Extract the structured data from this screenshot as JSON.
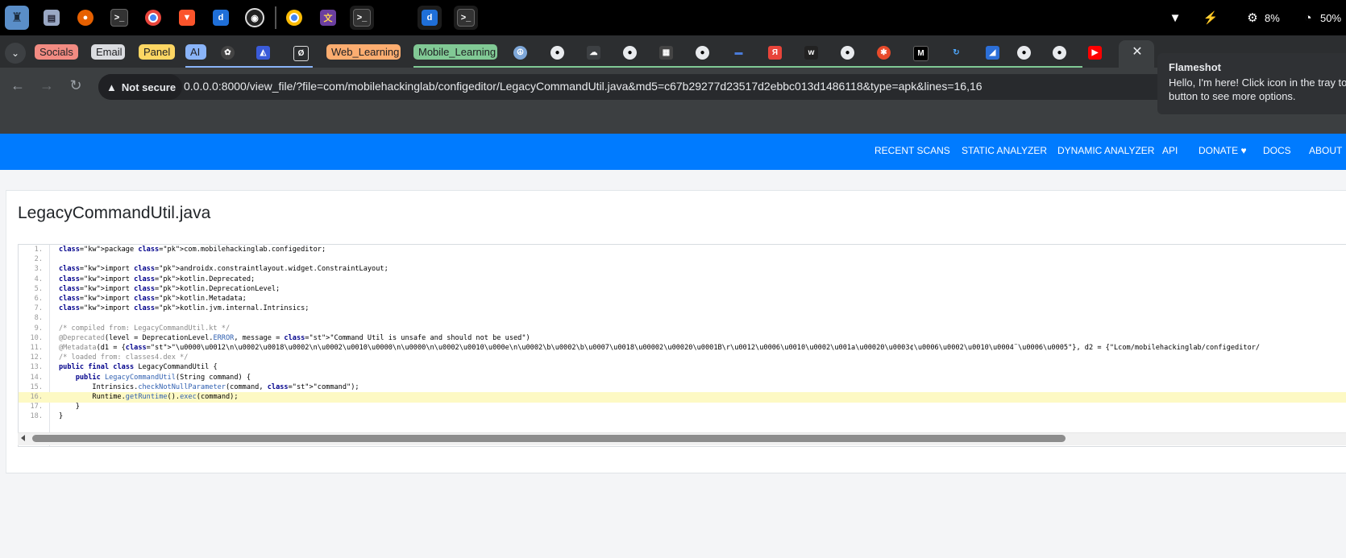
{
  "taskbar": {
    "apps": [
      "launcher-icon",
      "files-icon",
      "firefox-icon",
      "terminal-icon",
      "chrome-icon",
      "brave-icon",
      "jadx-icon",
      "obs-icon",
      "chrome-icon",
      "dict-icon",
      "terminal-icon",
      "jadx-icon",
      "terminal-icon"
    ],
    "tray": {
      "cpu": "8%",
      "battery": "50%"
    }
  },
  "tabs": {
    "groups": [
      {
        "label": "Socials",
        "color": "#f28b82"
      },
      {
        "label": "Email",
        "color": "#dadce0"
      },
      {
        "label": "Panel",
        "color": "#fdd663"
      },
      {
        "label": "AI",
        "color": "#8ab4f8"
      },
      {
        "label": "Web_Learning",
        "color": "#fcad70"
      },
      {
        "label": "Mobile_Learning",
        "color": "#81c995"
      }
    ],
    "close_symbol": "✕"
  },
  "toolbar": {
    "security_label": "Not secure",
    "url": "0.0.0.0:8000/view_file/?file=com/mobilehackinglab/configeditor/LegacyCommandUtil.java&md5=c67b29277d23517d2ebbc013d1486118&type=apk&lines=16,16"
  },
  "notification": {
    "title": "Flameshot",
    "body": "Hello, I'm here! Click icon in the tray to button to see more options."
  },
  "navbar": {
    "links": [
      "RECENT SCANS",
      "STATIC ANALYZER",
      "DYNAMIC ANALYZER",
      "API",
      "DONATE ♥",
      "DOCS",
      "ABOUT"
    ]
  },
  "file": {
    "title": "LegacyCommandUtil.java",
    "highlighted_line": 16,
    "line_numbers": [
      "1.",
      "2.",
      "3.",
      "4.",
      "5.",
      "6.",
      "7.",
      "8.",
      "9.",
      "10.",
      "11.",
      "12.",
      "13.",
      "14.",
      "15.",
      "16.",
      "17.",
      "18."
    ],
    "lines": [
      "package com.mobilehackinglab.configeditor;",
      "",
      "import androidx.constraintlayout.widget.ConstraintLayout;",
      "import kotlin.Deprecated;",
      "import kotlin.DeprecationLevel;",
      "import kotlin.Metadata;",
      "import kotlin.jvm.internal.Intrinsics;",
      "",
      "/* compiled from: LegacyCommandUtil.kt */",
      "@Deprecated(level = DeprecationLevel.ERROR, message = \"Command Util is unsafe and should not be used\")",
      "@Metadata(d1 = {\"\\u0000\\u0012\\n\\u0002\\u0018\\u0002\\n\\u0002\\u0010\\u0000\\n\\u0000\\n\\u0002\\u0010\\u000e\\n\\u0002\\b\\u0002\\b\\u0007\\u0018\\u00002\\u00020\\u0001B\\r\\u0012\\u0006\\u0010\\u0002\\u001a\\u00020\\u0003¢\\u0006\\u0002\\u0010\\u0004¨\\u0006\\u0005\"}, d2 = {\"Lcom/mobilehackinglab/configeditor/",
      "/* loaded from: classes4.dex */",
      "public final class LegacyCommandUtil {",
      "    public LegacyCommandUtil(String command) {",
      "        Intrinsics.checkNotNullParameter(command, \"command\");",
      "        Runtime.getRuntime().exec(command);",
      "    }",
      "}"
    ]
  }
}
